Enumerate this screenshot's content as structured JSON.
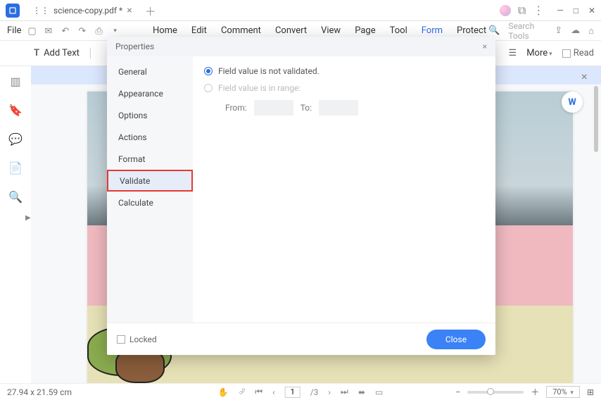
{
  "title_bar": {
    "tab_name": "science-copy.pdf *",
    "window_min": "—",
    "window_max": "□",
    "window_close": "✕"
  },
  "menu": {
    "file": "File",
    "items": {
      "home": "Home",
      "edit": "Edit",
      "comment": "Comment",
      "convert": "Convert",
      "view": "View",
      "page": "Page",
      "tool": "Tool",
      "form": "Form",
      "protect": "Protect"
    },
    "search_placeholder": "Search Tools"
  },
  "toolbar": {
    "add_text": "Add Text",
    "more": "More",
    "read": "Read"
  },
  "dialog": {
    "title": "Properties",
    "tabs": {
      "general": "General",
      "appearance": "Appearance",
      "options": "Options",
      "actions": "Actions",
      "format": "Format",
      "validate": "Validate",
      "calculate": "Calculate"
    },
    "validate": {
      "opt1": "Field value is not validated.",
      "opt2": "Field value is in range:",
      "from": "From:",
      "to": "To:"
    },
    "footer": {
      "locked": "Locked",
      "close": "Close"
    }
  },
  "status": {
    "dimensions": "27.94 x 21.59 cm",
    "page_current": "1",
    "page_total": "/3",
    "zoom": "70%"
  }
}
